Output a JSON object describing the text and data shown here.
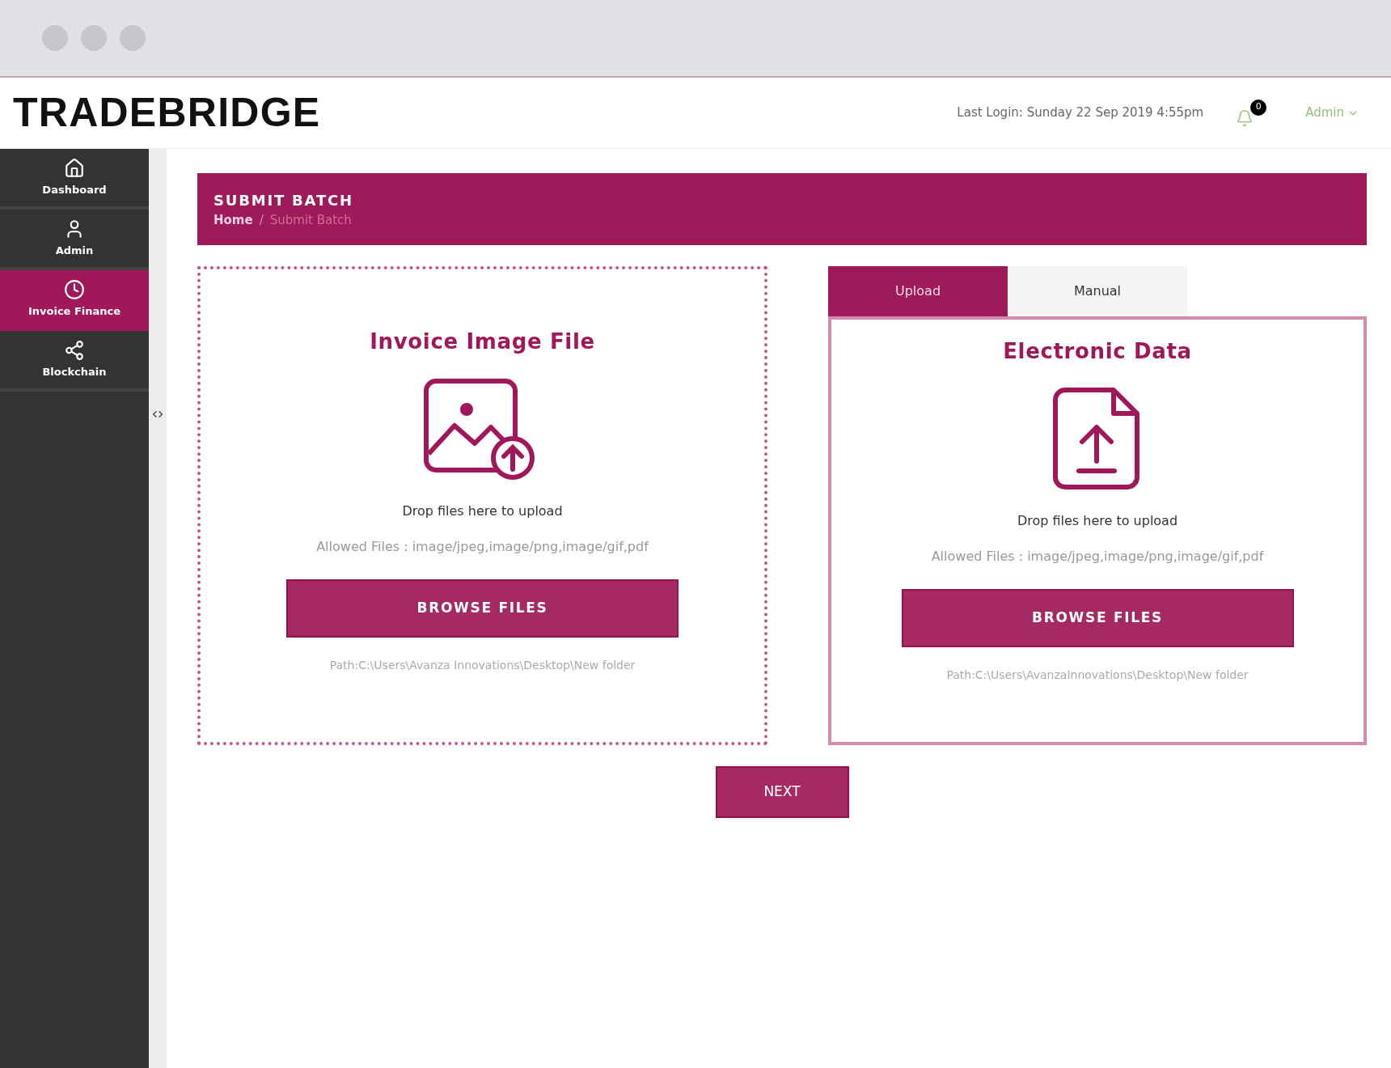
{
  "header": {
    "logo": "TRADEBRIDGE",
    "last_login": "Last Login: Sunday 22 Sep 2019 4:55pm",
    "notification_count": "0",
    "user_menu": "Admin"
  },
  "sidebar": {
    "items": [
      {
        "label": "Dashboard",
        "selected": false
      },
      {
        "label": "Admin",
        "selected": false
      },
      {
        "label": "Invoice Finance",
        "selected": true
      },
      {
        "label": "Blockchain",
        "selected": false
      }
    ]
  },
  "page_header": {
    "title": "SUBMIT BATCH",
    "breadcrumb_home": "Home",
    "breadcrumb_separator": "/",
    "breadcrumb_current": "Submit Batch"
  },
  "image_panel": {
    "title": "Invoice Image File",
    "drop_text": "Drop files here to upload",
    "allowed_files": "Allowed Files : image/jpeg,image/png,image/gif,pdf",
    "button": "BROWSE FILES",
    "path": "Path:C:\\Users\\Avanza Innovations\\Desktop\\New folder"
  },
  "data_panel": {
    "tabs": [
      {
        "label": "Upload",
        "selected": true
      },
      {
        "label": "Manual",
        "selected": false
      }
    ],
    "title": "Electronic Data",
    "drop_text": "Drop files here to upload",
    "allowed_files": "Allowed Files : image/jpeg,image/png,image/gif,pdf",
    "button": "BROWSE FILES",
    "path": "Path:C:\\Users\\AvanzaInnovations\\Desktop\\New folder"
  },
  "next_button": "NEXT"
}
